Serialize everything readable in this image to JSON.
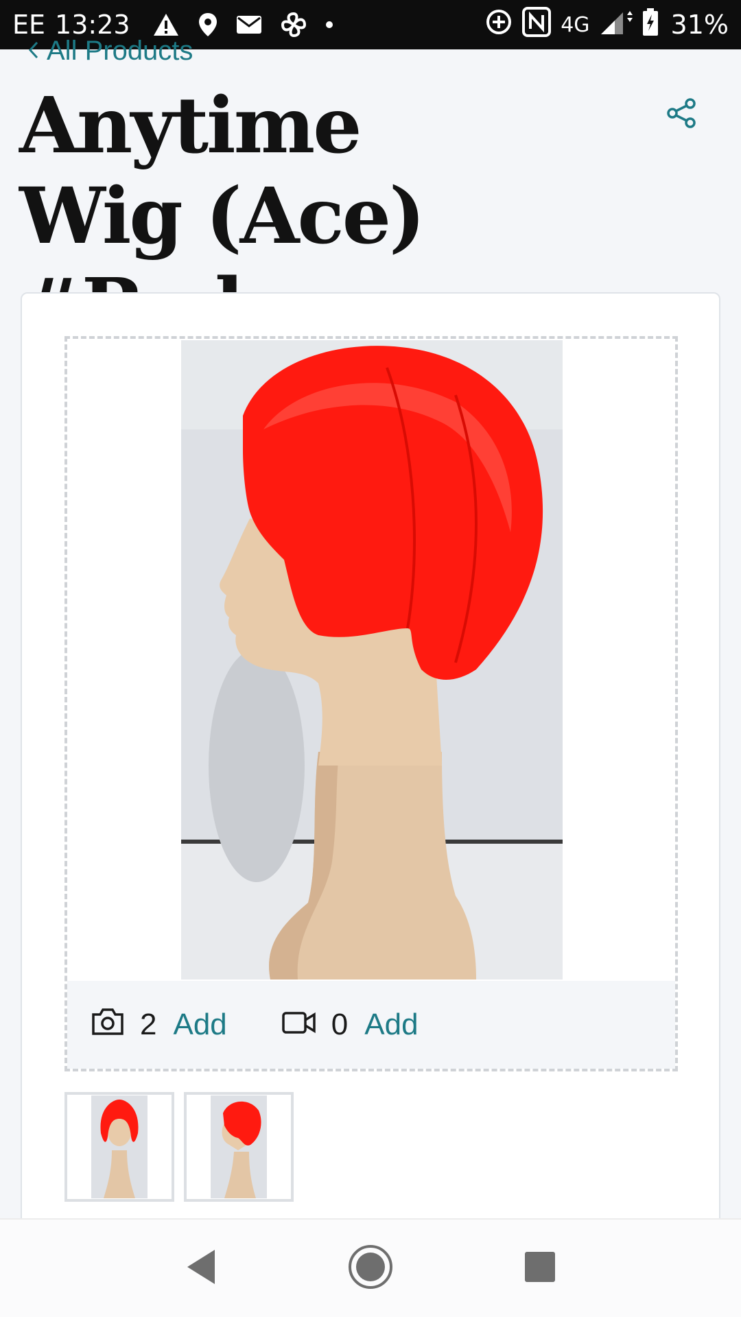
{
  "status_bar": {
    "carrier": "EE",
    "time": "13:23",
    "network": "4G",
    "battery": "31%"
  },
  "nav": {
    "back_label": "All Products"
  },
  "product": {
    "title": "Anytime Wig (Ace) #Red"
  },
  "media": {
    "photo_count": "2",
    "photo_add_label": "Add",
    "video_count": "0",
    "video_add_label": "Add"
  },
  "colors": {
    "accent": "#1d7a86",
    "wig_red": "#ff1a10",
    "mannequin": "#e3c6a6"
  },
  "icons": [
    "warning-icon",
    "location-icon",
    "mail-icon",
    "fan-icon",
    "sync-icon",
    "nfc-icon",
    "signal-icon",
    "battery-icon",
    "share-icon",
    "camera-icon",
    "video-icon",
    "back-icon",
    "home-icon",
    "recents-icon"
  ]
}
